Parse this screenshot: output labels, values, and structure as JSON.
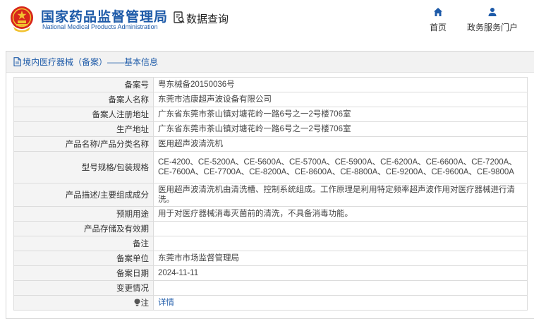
{
  "header": {
    "site_name_cn": "国家药品监督管理局",
    "site_name_en": "National Medical Products Administration",
    "section_label": "数据查询",
    "nav": [
      {
        "label": "首页",
        "icon": "home-icon"
      },
      {
        "label": "政务服务门户",
        "icon": "user-icon"
      }
    ]
  },
  "panel": {
    "title": "境内医疗器械（备案）——基本信息"
  },
  "record": {
    "rows": [
      {
        "label": "备案号",
        "value": "粤东械备20150036号"
      },
      {
        "label": "备案人名称",
        "value": "东莞市洁康超声波设备有限公司"
      },
      {
        "label": "备案人注册地址",
        "value": "广东省东莞市茶山镇对塘花岭一路6号之一2号楼706室"
      },
      {
        "label": "生产地址",
        "value": "广东省东莞市茶山镇对塘花岭一路6号之一2号楼706室"
      },
      {
        "label": "产品名称/产品分类名称",
        "value": "医用超声波清洗机"
      },
      {
        "label": "型号规格/包装规格",
        "value": "CE-4200、CE-5200A、CE-5600A、CE-5700A、CE-5900A、CE-6200A、CE-6600A、CE-7200A、CE-7600A、CE-7700A、CE-8200A、CE-8600A、CE-8800A、CE-9200A、CE-9600A、CE-9800A"
      },
      {
        "label": "产品描述/主要组成成分",
        "value": "医用超声波清洗机由清洗槽、控制系统组成。工作原理是利用特定频率超声波作用对医疗器械进行清洗。"
      },
      {
        "label": "预期用途",
        "value": "用于对医疗器械消毒灭菌前的清洗，不具备消毒功能。"
      },
      {
        "label": "产品存储及有效期",
        "value": ""
      },
      {
        "label": "备注",
        "value": ""
      },
      {
        "label": "备案单位",
        "value": "东莞市市场监督管理局"
      },
      {
        "label": "备案日期",
        "value": "2024-11-11"
      },
      {
        "label": "变更情况",
        "value": ""
      },
      {
        "label": "注",
        "value": "详情",
        "icon": "lightbulb-icon"
      }
    ]
  },
  "colors": {
    "brand_blue": "#1d5aa8",
    "emblem_red": "#d7261b",
    "emblem_gold": "#f2c230"
  }
}
